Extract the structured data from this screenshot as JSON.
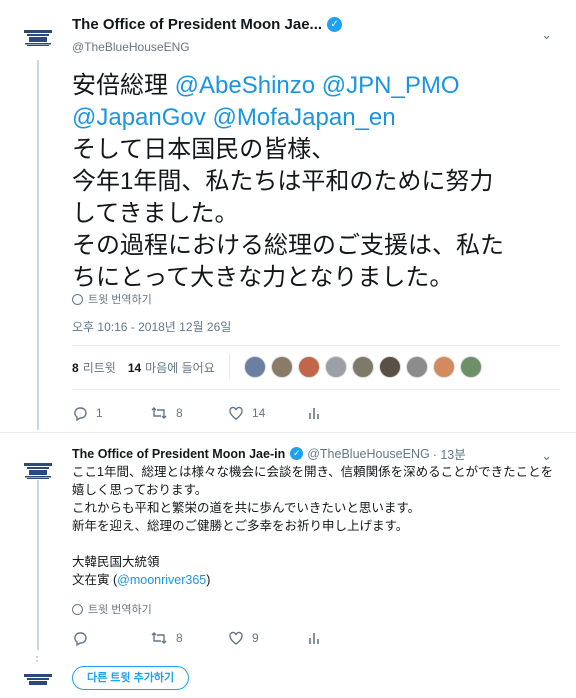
{
  "tweet1": {
    "author_name": "The Office of President Moon Jae...",
    "handle": "@TheBlueHouseENG",
    "lines": [
      {
        "text": "安倍総理 ",
        "mentions": [
          "@AbeShinzo",
          "@JPN_PMO"
        ]
      },
      {
        "text": "",
        "mentions": [
          "@JapanGov",
          "@MofaJapan_en"
        ]
      },
      {
        "text": "そして日本国民の皆様、",
        "mentions": []
      },
      {
        "text": "今年1年間、私たちは平和のために努力",
        "mentions": []
      },
      {
        "text": "してきました。",
        "mentions": []
      },
      {
        "text": "その過程における総理のご支援は、私た",
        "mentions": []
      },
      {
        "text": "ちにとって大きな力となりました。",
        "mentions": []
      }
    ],
    "translate_label": "트윗 번역하기",
    "timestamp": "오후 10:16 - 2018년 12월 26일",
    "retweets_count": "8",
    "retweets_label": "리트윗",
    "likes_count": "14",
    "likes_label": "마음에 들어요",
    "actions": {
      "reply": "1",
      "retweet": "8",
      "like": "14",
      "stats": ""
    }
  },
  "tweet2": {
    "author_name": "The Office of President Moon Jae-in",
    "handle": "@TheBlueHouseENG",
    "time": "· 13분",
    "text": "ここ1年間、総理とは様々な機会に会談を開き、信頼関係を深めることができたことを嬉しく思っております。\nこれからも平和と繁栄の道を共に歩んでいきたいと思います。\n新年を迎え、総理のご健勝とご多幸をお祈り申し上げます。\n\n大韓民国大統領\n文在寅 (",
    "mention": "@moonriver365",
    "text_end": ")",
    "translate_label": "트윗 번역하기",
    "actions": {
      "reply": "",
      "retweet": "8",
      "like": "9",
      "stats": ""
    }
  },
  "add_tweet_label": "다른 트윗 추가하기",
  "colors": {
    "accent": "#1da1f2",
    "mention": "#1b95e0",
    "muted": "#657786"
  },
  "avatar_colors": [
    "#6b7fa3",
    "#8a7b68",
    "#c2664a",
    "#9aa0a6",
    "#7e7a6a",
    "#5a5045",
    "#8c8c8c",
    "#d38b5d",
    "#6f8f6a"
  ]
}
